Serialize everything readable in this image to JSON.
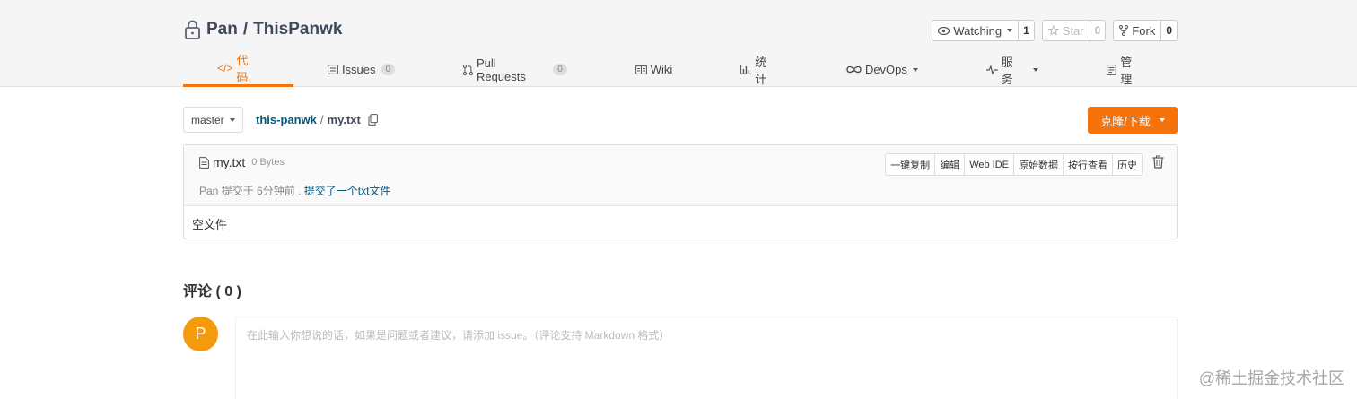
{
  "repo": {
    "owner": "Pan",
    "separator": "/",
    "name": "ThisPanwk"
  },
  "actions": {
    "watch_label": "Watching",
    "watch_count": "1",
    "star_label": "Star",
    "star_count": "0",
    "fork_label": "Fork",
    "fork_count": "0"
  },
  "tabs": [
    {
      "label": "代码",
      "icon": "code-icon",
      "badge": null
    },
    {
      "label": "Issues",
      "icon": "issues-icon",
      "badge": "0"
    },
    {
      "label": "Pull Requests",
      "icon": "pull-request-icon",
      "badge": "0"
    },
    {
      "label": "Wiki",
      "icon": "wiki-icon",
      "badge": null
    },
    {
      "label": "统计",
      "icon": "stats-icon",
      "badge": null
    },
    {
      "label": "DevOps",
      "icon": "devops-icon",
      "badge": null
    },
    {
      "label": "服务",
      "icon": "pulse-icon",
      "badge": null
    },
    {
      "label": "管理",
      "icon": "settings-icon",
      "badge": null
    }
  ],
  "branch": {
    "name": "master"
  },
  "breadcrumb": {
    "repo_link": "this-panwk",
    "sep": "/",
    "file": "my.txt"
  },
  "clone_button": "克隆/下载",
  "file": {
    "name": "my.txt",
    "size": "0 Bytes",
    "commit_author": "Pan",
    "commit_time": "提交于 6分钟前 .",
    "commit_message": "提交了一个txt文件",
    "actions": [
      "一键复制",
      "编辑",
      "Web IDE",
      "原始数据",
      "按行查看",
      "历史"
    ],
    "content": "空文件"
  },
  "comments": {
    "title": "评论 ( 0 )",
    "avatar_letter": "P",
    "placeholder": "在此输入你想说的话，如果是问题或者建议，请添加 issue。（评论支持 Markdown 格式）"
  },
  "watermark": "@稀土掘金技术社区",
  "colors": {
    "accent": "#f5730a",
    "link": "#005980",
    "avatar": "#f59a0a"
  }
}
